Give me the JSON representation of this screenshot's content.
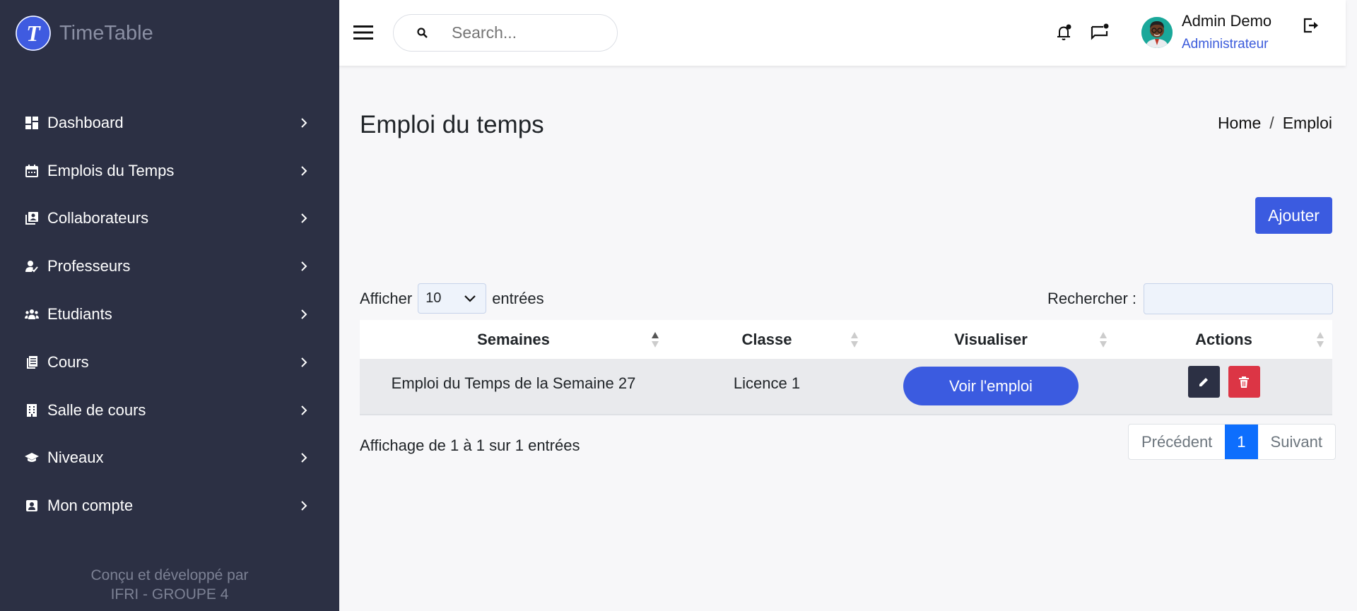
{
  "brand": {
    "name": "TimeTable",
    "logo_letter": "T"
  },
  "sidebar": {
    "items": [
      {
        "label": "Dashboard",
        "icon": "dashboard-icon"
      },
      {
        "label": "Emplois du Temps",
        "icon": "calendar-icon"
      },
      {
        "label": "Collaborateurs",
        "icon": "collaborators-icon"
      },
      {
        "label": "Professeurs",
        "icon": "teacher-icon"
      },
      {
        "label": "Etudiants",
        "icon": "students-icon"
      },
      {
        "label": "Cours",
        "icon": "course-icon"
      },
      {
        "label": "Salle de cours",
        "icon": "building-icon"
      },
      {
        "label": "Niveaux",
        "icon": "graduation-cap-icon"
      },
      {
        "label": "Mon compte",
        "icon": "account-icon"
      }
    ],
    "footer_line1": "Conçu et développé par",
    "footer_line2": "IFRI - GROUPE 4"
  },
  "header": {
    "search_placeholder": "Search...",
    "user_name": "Admin Demo",
    "user_role": "Administrateur"
  },
  "main": {
    "title": "Emploi du temps",
    "breadcrumb": {
      "home": "Home",
      "separator": "/",
      "current": "Emploi"
    },
    "add_button": "Ajouter",
    "length": {
      "prefix": "Afficher",
      "value": "10",
      "suffix": "entrées"
    },
    "filter_label": "Rechercher :",
    "table": {
      "headers": [
        "Semaines",
        "Classe",
        "Visualiser",
        "Actions"
      ],
      "rows": [
        {
          "semaine": "Emploi du Temps de la Semaine 27",
          "classe": "Licence 1",
          "view_button": "Voir l'emploi"
        }
      ]
    },
    "info": "Affichage de 1 à 1 sur 1 entrées",
    "pagination": {
      "prev": "Précédent",
      "current": "1",
      "next": "Suivant"
    }
  },
  "colors": {
    "sidebar": "#2c3044",
    "accent": "#3b5be0",
    "danger": "#dc3545"
  }
}
